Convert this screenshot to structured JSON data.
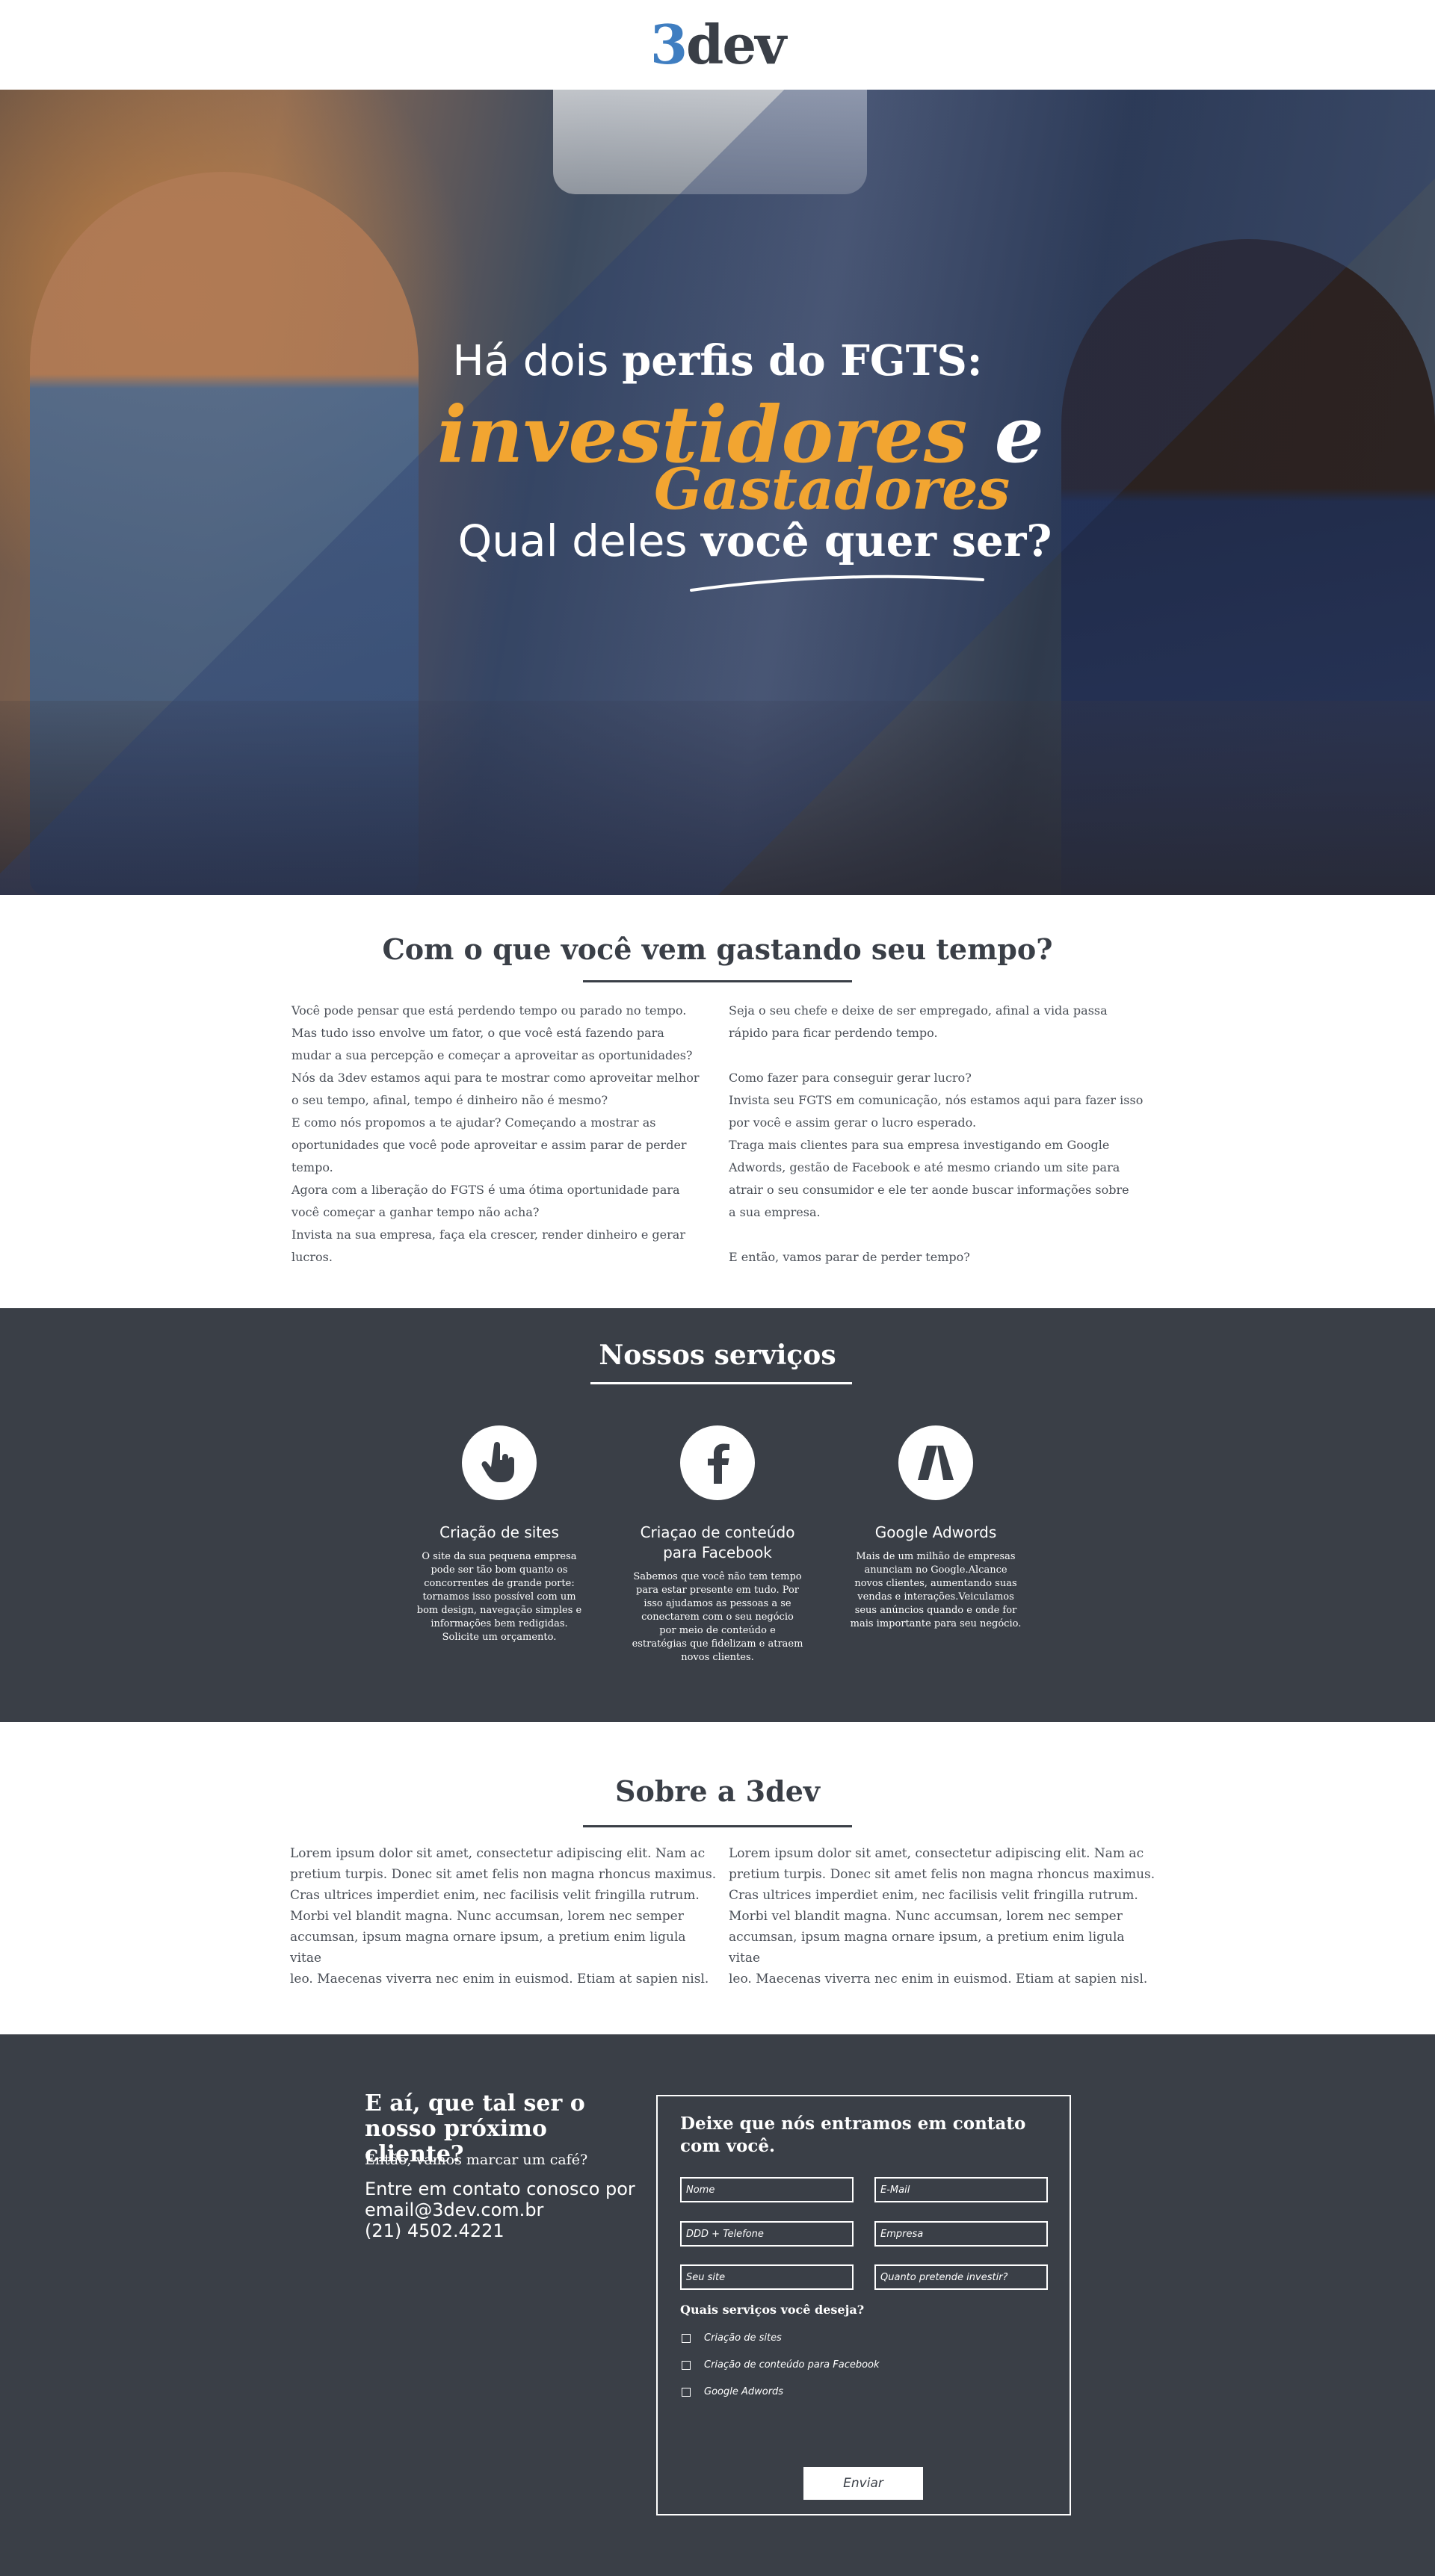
{
  "header": {
    "logo_num": "3",
    "logo_text": "dev"
  },
  "hero": {
    "line1_light": "Há dois ",
    "line1_bold": "perfis do FGTS:",
    "line2_a": "investidores ",
    "line2_e": "e",
    "line3": "Gastadores",
    "line4_light": "Qual deles ",
    "line4_bold": "você quer ser?"
  },
  "intro": {
    "title": "Com o que você vem gastando seu tempo?",
    "left": "Você pode pensar que está perdendo tempo ou parado no tempo.\nMas tudo isso envolve um fator, o que você está fazendo para\nmudar a sua percepção e começar a aproveitar as oportunidades?\nNós da 3dev estamos aqui para te mostrar como aproveitar melhor\no seu tempo, afinal, tempo é dinheiro não é mesmo?\nE como nós propomos a te ajudar? Começando a mostrar as\noportunidades que você pode aproveitar e assim parar de perder\ntempo.\nAgora com a liberação do FGTS é uma ótima oportunidade para\nvocê começar a ganhar tempo não acha?\nInvista na sua empresa, faça ela crescer, render dinheiro e gerar\nlucros.",
    "right": "Seja o seu chefe e deixe de ser empregado, afinal a vida passa\nrápido para ficar perdendo tempo.\n\nComo fazer para conseguir gerar lucro?\nInvista seu FGTS em comunicação, nós estamos aqui para fazer isso\npor você e assim gerar o lucro esperado.\nTraga mais clientes para sua empresa investigando em Google\nAdwords, gestão de Facebook e até mesmo criando um site para\natrair o seu consumidor e ele ter aonde buscar informações sobre\na sua empresa.\n\nE então, vamos parar de perder tempo?"
  },
  "services": {
    "title": "Nossos serviços",
    "items": [
      {
        "icon": "pointer-hand-icon",
        "name": "Criação de sites",
        "desc": "O site da sua pequena empresa pode ser tão bom quanto os concorrentes de grande porte: tornamos isso possível com um bom design, navegação simples e informações bem redigidas. Solicite um orçamento."
      },
      {
        "icon": "facebook-icon",
        "name": "Criaçao de conteúdo para Facebook",
        "desc": "Sabemos que você não tem tempo para estar presente em tudo. Por isso ajudamos as pessoas a se conectarem com o seu negócio por meio de conteúdo e estratégias que fidelizam e atraem novos clientes."
      },
      {
        "icon": "google-adwords-icon",
        "name": "Google Adwords",
        "desc": "Mais de um milhão de empresas anunciam no Google.Alcance novos clientes, aumentando suas vendas e interações.Veiculamos seus anúncios quando e onde for mais importante para seu negócio."
      }
    ]
  },
  "about": {
    "title": "Sobre a 3dev",
    "left": "Lorem ipsum dolor sit amet, consectetur adipiscing elit. Nam ac\npretium turpis. Donec sit amet felis non magna rhoncus maximus.\nCras ultrices imperdiet enim, nec facilisis velit fringilla rutrum.\nMorbi vel blandit magna. Nunc accumsan, lorem nec semper\naccumsan, ipsum magna ornare ipsum, a pretium enim ligula vitae\nleo. Maecenas viverra nec enim in euismod. Etiam at sapien nisl.",
    "right": "Lorem ipsum dolor sit amet, consectetur adipiscing elit. Nam ac\npretium turpis. Donec sit amet felis non magna rhoncus maximus.\nCras ultrices imperdiet enim, nec facilisis velit fringilla rutrum.\nMorbi vel blandit magna. Nunc accumsan, lorem nec semper\naccumsan, ipsum magna ornare ipsum, a pretium enim ligula vitae\nleo. Maecenas viverra nec enim in euismod. Etiam at sapien nisl."
  },
  "contact": {
    "title": "E aí, que tal ser o nosso próximo cliente?",
    "subtitle": "Então, vamos marcar um café?",
    "line1": "Entre em contato conosco por",
    "email": "email@3dev.com.br",
    "phone": "(21)  4502.4221",
    "form": {
      "title": "Deixe que nós entramos em contato com você.",
      "name_ph": "Nome",
      "email_ph": "E-Mail",
      "phone_ph": "DDD + Telefone",
      "company_ph": "Empresa",
      "site_ph": "Seu site",
      "invest_ph": "Quanto pretende investir?",
      "question": "Quais serviços você deseja?",
      "options": [
        "Criação de sites",
        "Criação de conteúdo para Facebook",
        "Google Adwords"
      ],
      "submit": "Enviar"
    }
  },
  "colors": {
    "dark": "#3a3f47",
    "accent": "#f2a531",
    "logo_blue": "#3f7ec1"
  }
}
